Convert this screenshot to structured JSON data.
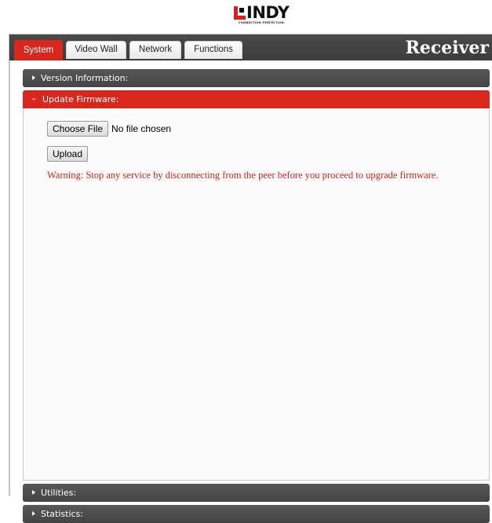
{
  "brand": {
    "name": "INDY",
    "tagline": "CONNECTION PERFECTION"
  },
  "tabs": [
    {
      "label": "System",
      "active": true
    },
    {
      "label": "Video Wall",
      "active": false
    },
    {
      "label": "Network",
      "active": false
    },
    {
      "label": "Functions",
      "active": false
    }
  ],
  "device_title": "Receiver",
  "sections": {
    "version": {
      "label": "Version Information:",
      "expanded": false
    },
    "firmware": {
      "label": "Update Firmware:",
      "expanded": true
    },
    "utilities": {
      "label": "Utilities:",
      "expanded": false
    },
    "statistics": {
      "label": "Statistics:",
      "expanded": false
    }
  },
  "firmware": {
    "choose_file_label": "Choose File",
    "file_status": "No file chosen",
    "upload_label": "Upload",
    "warning": "Warning: Stop any service by disconnecting from the peer before you proceed to upgrade firmware."
  },
  "colors": {
    "accent": "#d9271d",
    "header_dark": "#4a4a4a",
    "warning_text": "#e0201a"
  }
}
